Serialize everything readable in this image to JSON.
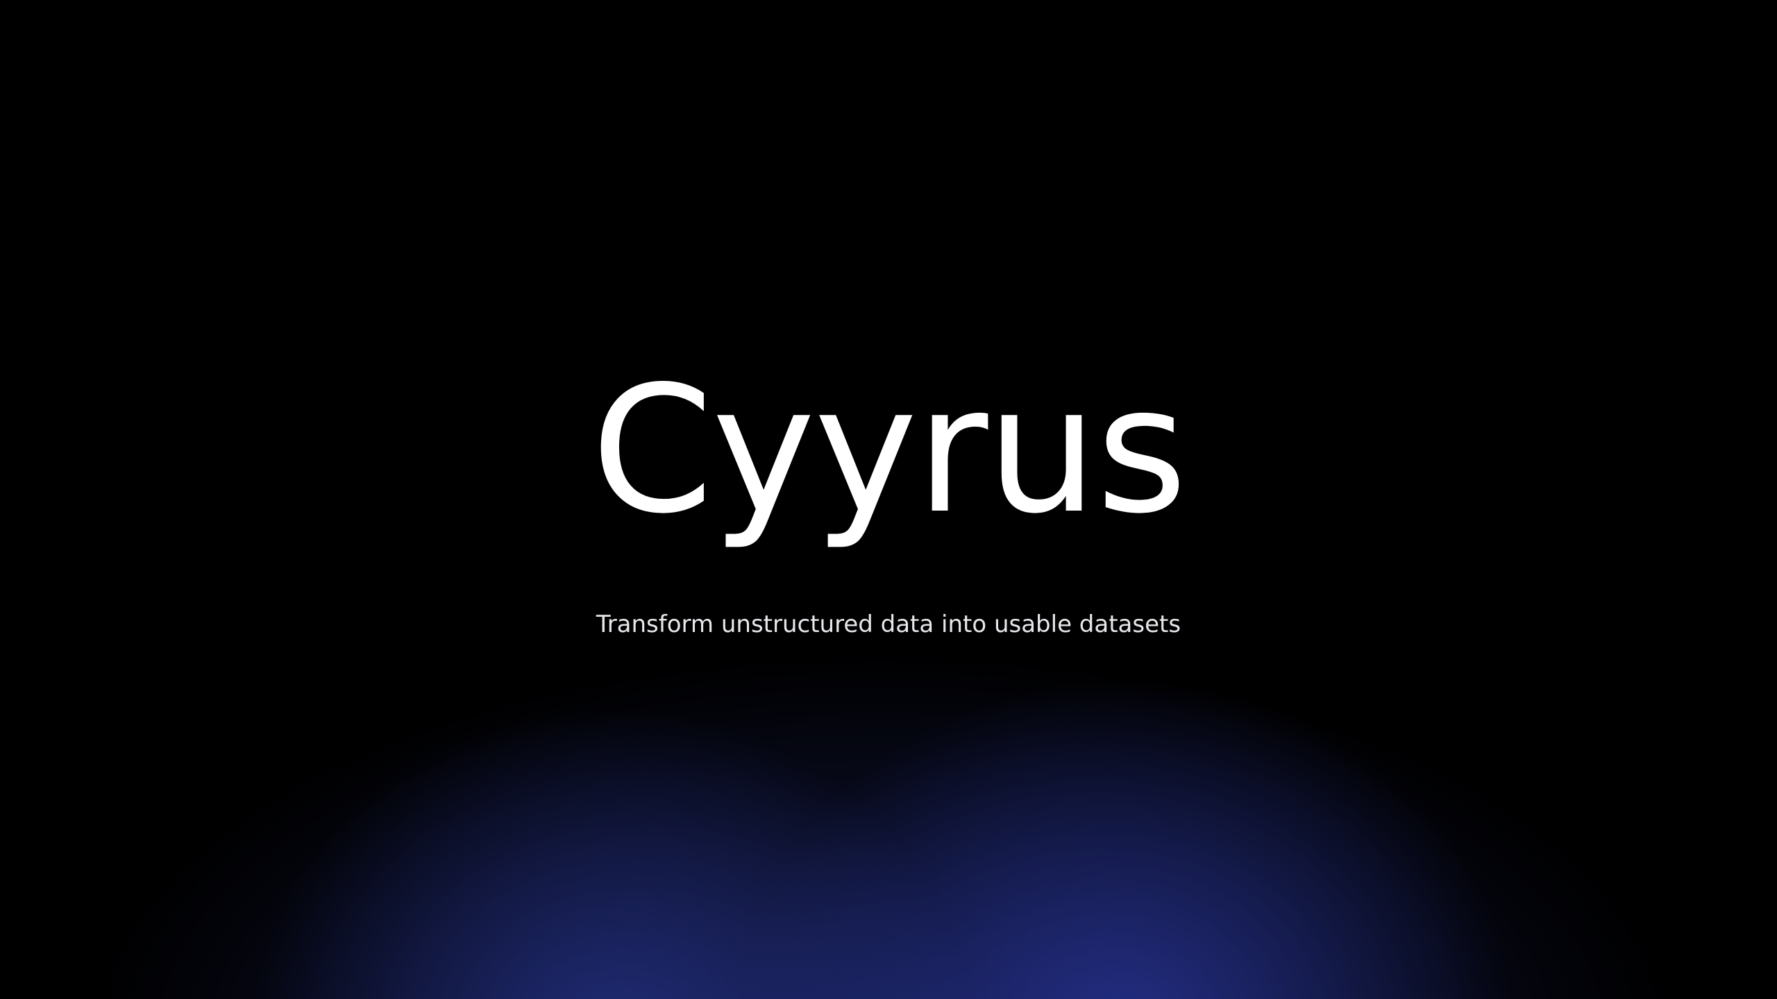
{
  "hero": {
    "title": "Cyyrus",
    "tagline": "Transform unstructured data into usable datasets"
  },
  "colors": {
    "background": "#000000",
    "glow": "#26348c",
    "title_text": "#ffffff",
    "tagline_text": "#e8e8ec"
  }
}
